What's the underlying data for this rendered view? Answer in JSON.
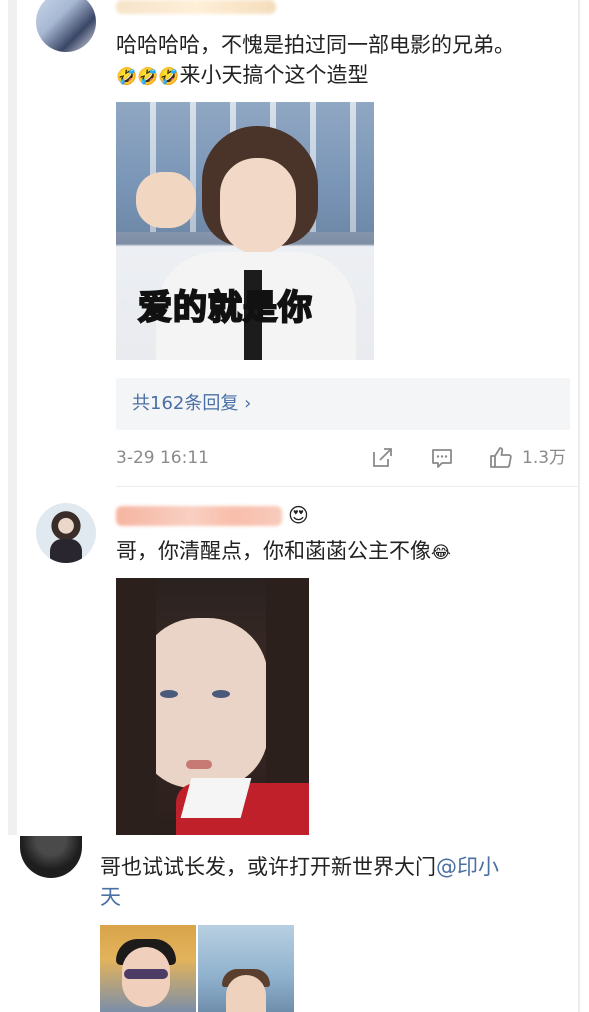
{
  "comments": [
    {
      "username": "",
      "text_line1": "哈哈哈哈，不愧是拍过同一部电影的兄弟。",
      "text_line2": "来小天搞个这个造型",
      "emoji": "🤣",
      "image_caption": "爱的就是你",
      "reply_link": "共162条回复 ›",
      "timestamp": "3-29 16:11",
      "like_count": "1.3万"
    },
    {
      "username": "",
      "badge_emoji": "😍",
      "text": "哥，你清醒点，你和菡菡公主不像",
      "emoji": "😂"
    },
    {
      "text_line1": "哥也试试长发，或许打开新世界大门",
      "mention": "@印小",
      "text_line2": "天"
    }
  ],
  "icons": {
    "share": "share-icon",
    "comment": "comment-icon",
    "like": "thumbs-up-icon"
  },
  "colors": {
    "link": "#4a6fa5",
    "meta": "#8a8a8a",
    "reply_bg": "#f4f5f7"
  }
}
